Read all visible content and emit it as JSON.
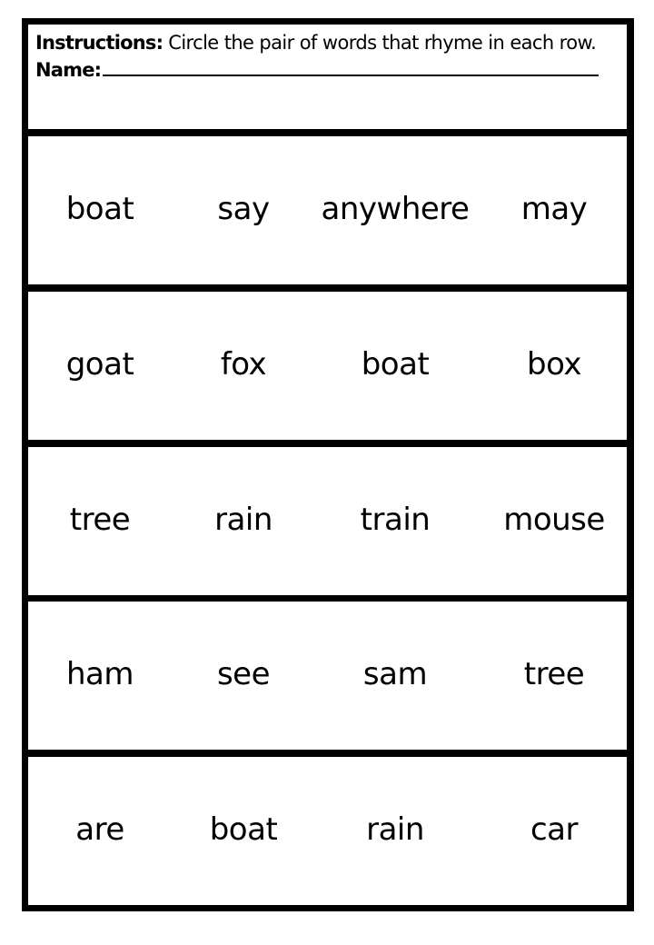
{
  "header": {
    "instructions_label": "Instructions:",
    "instructions_text": "Circle the pair of words that rhyme in each row.",
    "name_label": "Name:"
  },
  "rows": [
    {
      "words": [
        "boat",
        "say",
        "anywhere",
        "may"
      ]
    },
    {
      "words": [
        "goat",
        "fox",
        "boat",
        "box"
      ]
    },
    {
      "words": [
        "tree",
        "rain",
        "train",
        "mouse"
      ]
    },
    {
      "words": [
        "ham",
        "see",
        "sam",
        "tree"
      ]
    },
    {
      "words": [
        "are",
        "boat",
        "rain",
        "car"
      ]
    }
  ]
}
